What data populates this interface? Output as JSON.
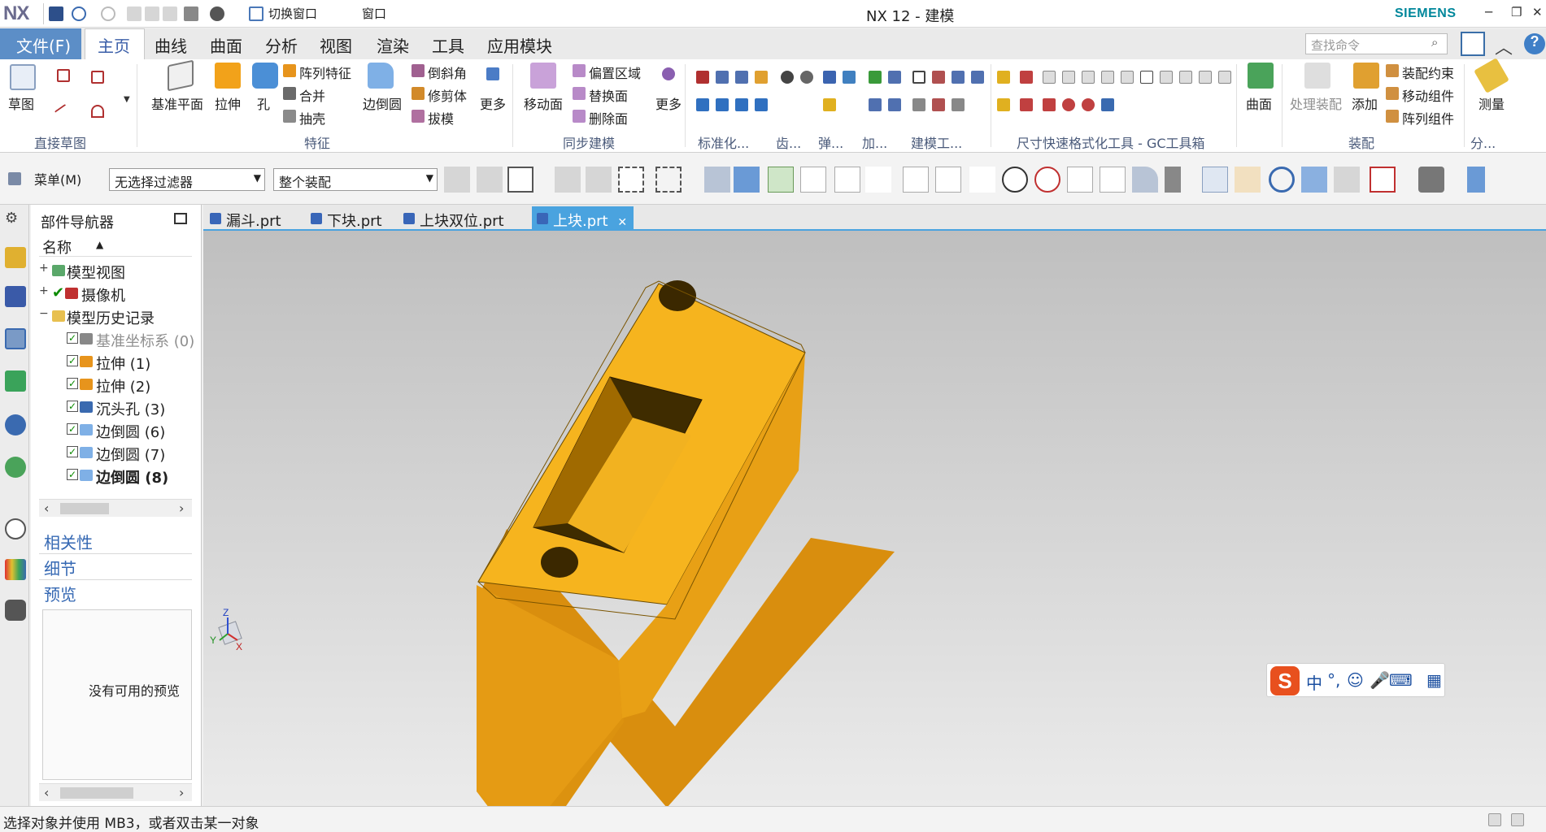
{
  "titlebar": {
    "logo": "NX",
    "switch_window": "切换窗口",
    "window_menu": "窗口",
    "app_title": "NX 12 - 建模",
    "brand": "SIEMENS"
  },
  "tabs": {
    "file": "文件(F)",
    "items": [
      "主页",
      "曲线",
      "曲面",
      "分析",
      "视图",
      "渲染",
      "工具",
      "应用模块"
    ],
    "search_placeholder": "查找命令"
  },
  "ribbon": {
    "sketch": "草图",
    "direct_sketch_group": "直接草图",
    "datum_plane": "基准平面",
    "extrude": "拉伸",
    "hole": "孔",
    "pattern_feature": "阵列特征",
    "unite": "合并",
    "shell": "抽壳",
    "edge_blend": "边倒圆",
    "chamfer": "倒斜角",
    "trim_body": "修剪体",
    "draft": "拔模",
    "more": "更多",
    "feature_group": "特征",
    "move_face": "移动面",
    "offset_region": "偏置区域",
    "replace_face": "替换面",
    "delete_face": "删除面",
    "more2": "更多",
    "sync_group": "同步建模",
    "standard_group": "标准化...",
    "gear_group": "齿...",
    "spring_group": "弹...",
    "add_group": "加...",
    "modeling_tools_group": "建模工...",
    "dim_group": "尺寸快速格式化工具 - GC工具箱",
    "surface": "曲面",
    "process_assembly": "处理装配",
    "add": "添加",
    "assembly_constraint": "装配约束",
    "move_component": "移动组件",
    "pattern_component": "阵列组件",
    "assembly_group": "装配",
    "measure": "测量",
    "analysis_group": "分..."
  },
  "selbar": {
    "menu": "菜单(M)",
    "filter": "无选择过滤器",
    "scope": "整个装配"
  },
  "navigator": {
    "title": "部件导航器",
    "column": "名称",
    "nodes": [
      {
        "label": "模型视图"
      },
      {
        "label": "摄像机"
      },
      {
        "label": "模型历史记录"
      },
      {
        "label": "基准坐标系 (0)"
      },
      {
        "label": "拉伸 (1)"
      },
      {
        "label": "拉伸 (2)"
      },
      {
        "label": "沉头孔 (3)"
      },
      {
        "label": "边倒圆 (6)"
      },
      {
        "label": "边倒圆 (7)"
      },
      {
        "label": "边倒圆 (8)"
      }
    ],
    "dependencies": "相关性",
    "details": "细节",
    "preview": "预览",
    "no_preview": "没有可用的预览"
  },
  "doctabs": [
    {
      "label": "漏斗.prt"
    },
    {
      "label": "下块.prt"
    },
    {
      "label": "上块双位.prt"
    },
    {
      "label": "上块.prt"
    }
  ],
  "viewport": {
    "triad_x": "X",
    "triad_y": "Y",
    "triad_z": "Z",
    "ime_lang": "中"
  },
  "status": {
    "text": "选择对象并使用 MB3，或者双击某一对象"
  },
  "colors": {
    "accent": "#5c8ec7",
    "active_tab": "#4aa3df",
    "part_yellow": "#f5b31c",
    "brand": "#00879b"
  }
}
